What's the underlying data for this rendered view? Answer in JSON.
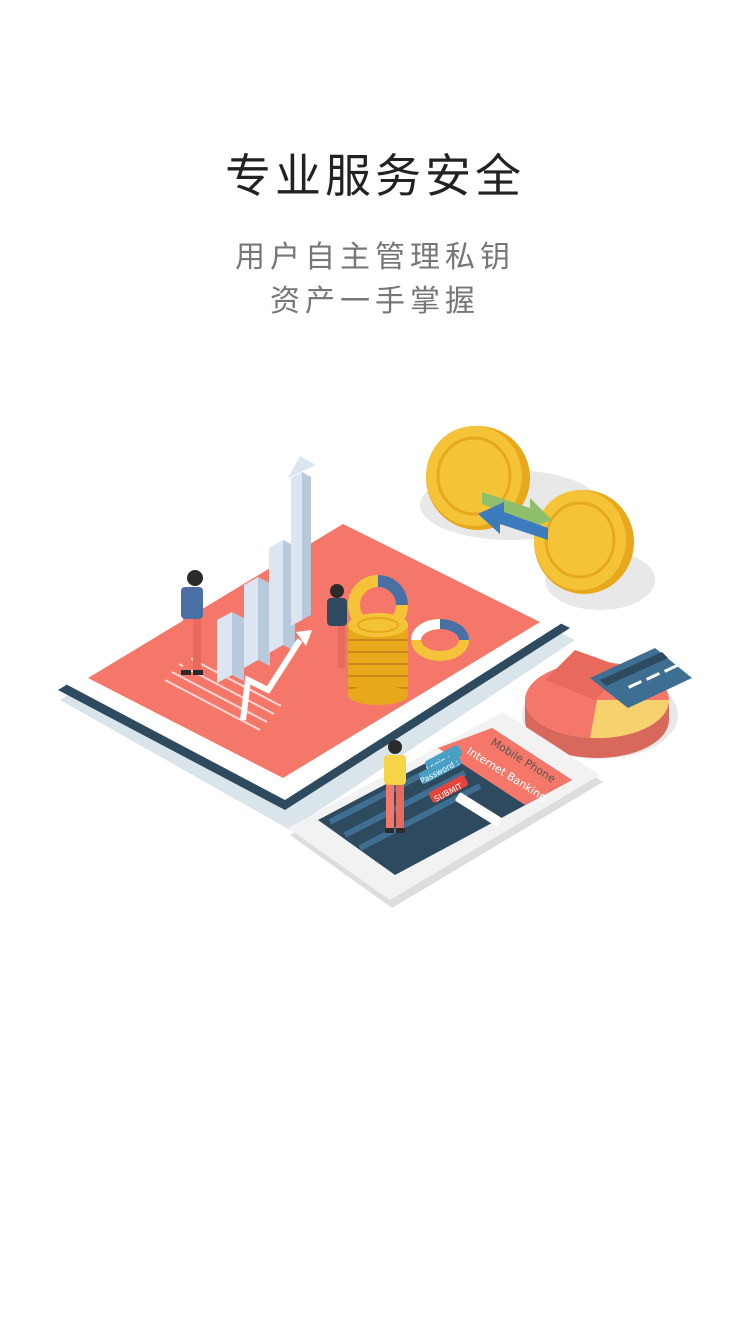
{
  "intro": {
    "title": "专业服务安全",
    "subtitle_line1": "用户自主管理私钥",
    "subtitle_line2": "资产一手掌握"
  },
  "illustration": {
    "phone_header": "Mobile Phone",
    "phone_title": "Internet Banking",
    "login_label": "Login :",
    "password_label": "Password :",
    "submit_label": "SUBMIT"
  },
  "colors": {
    "accent_red": "#f47769",
    "navy": "#2e4a5e",
    "gold": "#f5c338",
    "light_blue": "#dbe6f2"
  }
}
